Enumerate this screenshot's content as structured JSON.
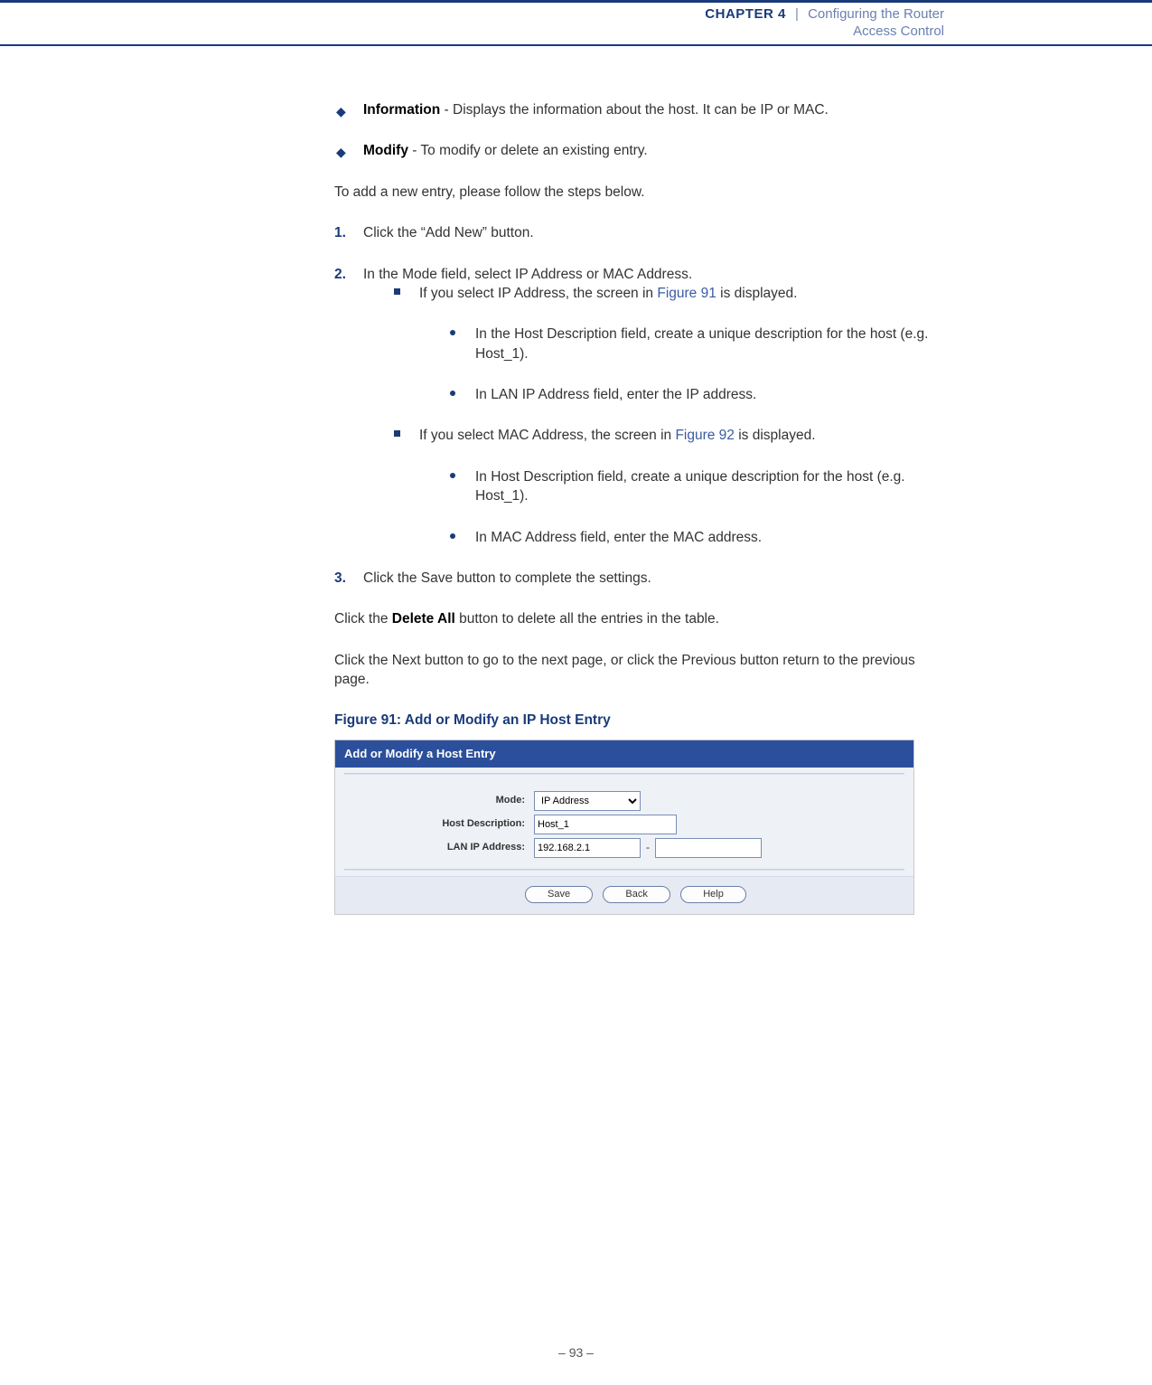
{
  "header": {
    "chapter_label": "CHAPTER 4",
    "pipe": "|",
    "chapter_title": "Configuring the Router",
    "section_title": "Access Control"
  },
  "bullets": {
    "info_bold": "Information",
    "info_rest": " - Displays the information about the host. It can be IP or MAC.",
    "modify_bold": "Modify",
    "modify_rest": " - To modify or delete an existing entry."
  },
  "intro": "To add a new entry, please follow the steps below.",
  "steps": {
    "s1_num": "1.",
    "s1": "Click the “Add New” button.",
    "s2_num": "2.",
    "s2": "In the Mode field, select IP Address or MAC Address.",
    "s2a_pre": "If you select IP Address, the screen in ",
    "s2a_link": "Figure 91",
    "s2a_post": " is displayed.",
    "s2a_i": "In the Host Description field, create a unique description for the host (e.g. Host_1).",
    "s2a_ii": "In LAN IP Address field, enter the IP address.",
    "s2b_pre": "If you select MAC Address, the screen in ",
    "s2b_link": "Figure 92",
    "s2b_post": " is displayed.",
    "s2b_i": "In Host Description field, create a unique description for the host (e.g. Host_1).",
    "s2b_ii": "In MAC Address field, enter the MAC address.",
    "s3_num": "3.",
    "s3": "Click the Save button to complete the settings."
  },
  "after": {
    "p1_pre": "Click the ",
    "p1_bold": "Delete All",
    "p1_post": " button to delete all the entries in the table.",
    "p2": "Click the Next button to go to the next page, or click the Previous button return to the previous page."
  },
  "figure": {
    "caption": "Figure 91:  Add or Modify an IP Host Entry",
    "titlebar": "Add or Modify a Host Entry",
    "mode_label": "Mode:",
    "mode_value": "IP Address",
    "hostdesc_label": "Host Description:",
    "hostdesc_value": "Host_1",
    "lanip_label": "LAN IP Address:",
    "lanip_from": "192.168.2.1",
    "lanip_dash": "-",
    "lanip_to": "",
    "btn_save": "Save",
    "btn_back": "Back",
    "btn_help": "Help"
  },
  "footer": "–  93  –"
}
